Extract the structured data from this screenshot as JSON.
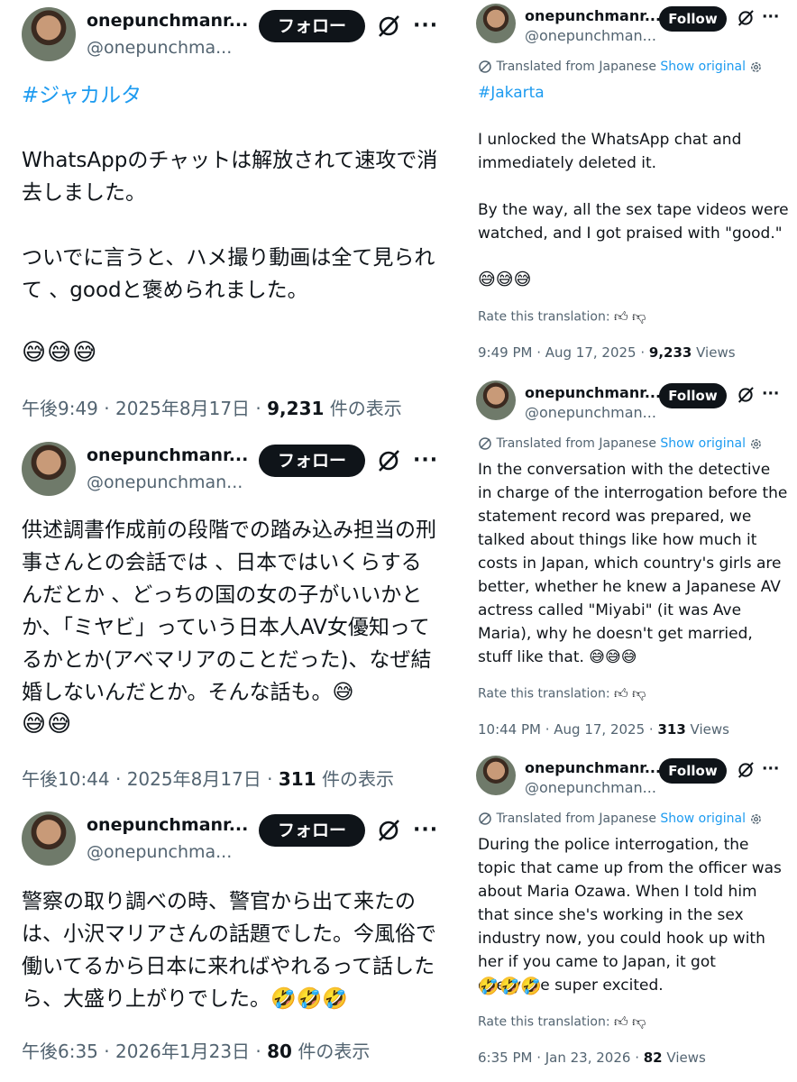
{
  "left": {
    "tweets": [
      {
        "name": "onepunchmanr...",
        "handle": "@onepunchma...",
        "follow": "フォロー",
        "hashtag": "#ジャカルタ",
        "p1": "WhatsAppのチャットは解放されて速攻で消去しました。",
        "p2": "ついでに言うと、ハメ撮り動画は全て見られて 、goodと褒められました。",
        "emoji": "😅😅😅",
        "time": "午後9:49 · 2025年8月17日 · ",
        "views": "9,231",
        "views_suffix": " 件の表示"
      },
      {
        "name": "onepunchmanr...",
        "handle": "@onepunchman...",
        "follow": "フォロー",
        "p1": "供述調書作成前の段階での踏み込み担当の刑事さんとの会話では 、日本ではいくらするんだとか 、どっちの国の女の子がいいかとか、「ミヤビ」っていう日本人AV女優知ってるかとか(アベマリアのことだった)、なぜ結婚しないんだとか。そんな話も。😅",
        "emoji": "😅😅",
        "time": "午後10:44 · 2025年8月17日 · ",
        "views": "311",
        "views_suffix": " 件の表示"
      },
      {
        "name": "onepunchmanr...",
        "handle": "@onepunchma...",
        "follow": "フォロー",
        "p1": "警察の取り調べの時、警官から出て来たのは、小沢マリアさんの話題でした。今風俗で働いてるから日本に来ればやれるって話したら、大盛り上がりでした。🤣🤣🤣",
        "time": "午後6:35 · 2026年1月23日 · ",
        "views": "80",
        "views_suffix": " 件の表示"
      }
    ]
  },
  "right": {
    "tweets": [
      {
        "name": "onepunchmanr...",
        "handle": "@onepunchman...",
        "follow": "Follow",
        "translated": "Translated from Japanese",
        "show_original": "Show original",
        "hashtag": "#Jakarta",
        "p1": "I unlocked the WhatsApp chat and immediately deleted it.",
        "p2": "By the way, all the sex tape videos were watched, and I got praised with \"good.\"",
        "emoji": "😅😅😅",
        "rate": "Rate this translation:",
        "time": "9:49 PM · Aug 17, 2025 · ",
        "views": "9,233",
        "views_suffix": " Views"
      },
      {
        "name": "onepunchmanr...",
        "handle": "@onepunchman...",
        "follow": "Follow",
        "translated": "Translated from Japanese",
        "show_original": "Show original",
        "p1": "In the conversation with the detective in charge of the interrogation before the statement record was prepared, we talked about things like how much it costs in Japan, which country's girls are better, whether he knew a Japanese AV actress called \"Miyabi\" (it was Ave Maria), why he doesn't get married, stuff like that. 😅😅😅",
        "rate": "Rate this translation:",
        "time": "10:44 PM · Aug 17, 2025 · ",
        "views": "313",
        "views_suffix": " Views"
      },
      {
        "name": "onepunchmanr...",
        "handle": "@onepunchman...",
        "follow": "Follow",
        "translated": "Translated from Japanese",
        "show_original": "Show original",
        "p1": "During the police interrogation, the topic that came up from the officer was about Maria Ozawa. When I told him that since she's working in the sex industry now, you could hook up with her if you came to Japan, it got everyone super excited.",
        "emoji": "🤣🤣🤣",
        "rate": "Rate this translation:",
        "time": "6:35 PM · Jan 23, 2026 · ",
        "views": "82",
        "views_suffix": " Views"
      }
    ]
  },
  "icons": {
    "avatar": "profile-photo",
    "grok": "grok-slash-circle-icon",
    "more": "more-dots-icon",
    "translate": "translate-icon",
    "settings": "gear-icon",
    "thumbs_up": "thumbs-up-icon",
    "thumbs_down": "thumbs-down-icon"
  },
  "colors": {
    "accent": "#1d9bf0",
    "text": "#0f1419",
    "muted": "#536471",
    "button": "#0f1419"
  }
}
